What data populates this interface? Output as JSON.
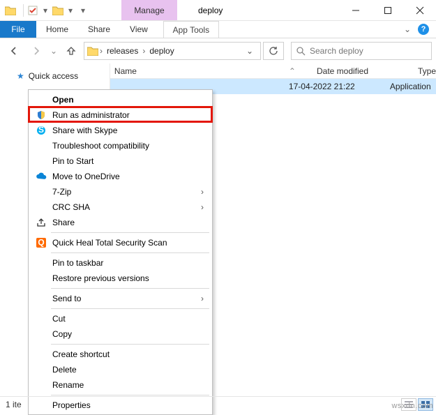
{
  "titlebar": {
    "context_tab": "Manage",
    "title": "deploy"
  },
  "ribbon": {
    "file": "File",
    "tabs": [
      "Home",
      "Share",
      "View"
    ],
    "context_tool": "App Tools"
  },
  "nav": {
    "breadcrumb": [
      "releases",
      "deploy"
    ],
    "search_placeholder": "Search deploy"
  },
  "columns": {
    "name": "Name",
    "date": "Date modified",
    "type": "Type"
  },
  "row": {
    "date": "17-04-2022 21:22",
    "type": "Application"
  },
  "sidebar": {
    "quick_access": "Quick access"
  },
  "context_menu": {
    "open": "Open",
    "run_admin": "Run as administrator",
    "share_skype": "Share with Skype",
    "troubleshoot": "Troubleshoot compatibility",
    "pin_start": "Pin to Start",
    "move_onedrive": "Move to OneDrive",
    "seven_zip": "7-Zip",
    "crc_sha": "CRC SHA",
    "share": "Share",
    "qh_scan": "Quick Heal Total Security Scan",
    "pin_taskbar": "Pin to taskbar",
    "restore": "Restore previous versions",
    "send_to": "Send to",
    "cut": "Cut",
    "copy": "Copy",
    "create_shortcut": "Create shortcut",
    "delete": "Delete",
    "rename": "Rename",
    "properties": "Properties"
  },
  "status": {
    "items": "1 ite"
  },
  "watermark": "wsxdn.com"
}
